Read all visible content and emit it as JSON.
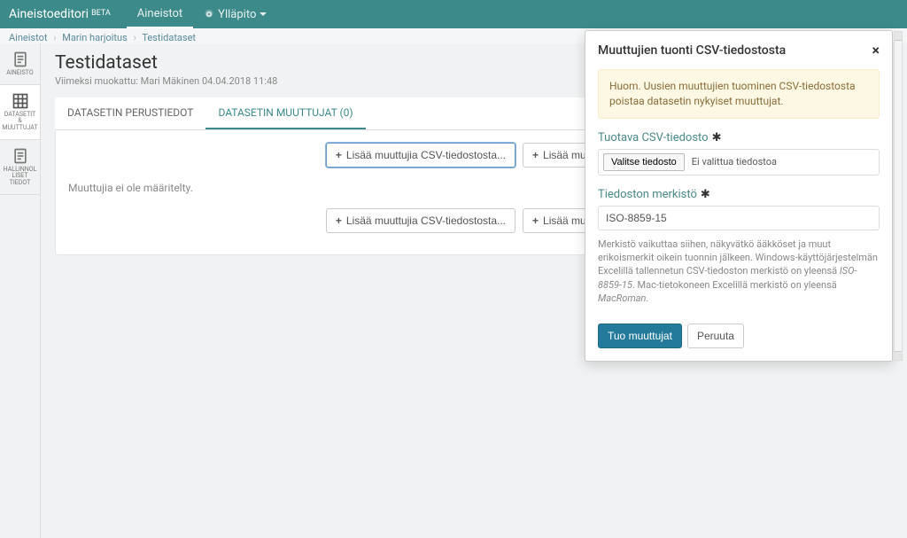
{
  "navbar": {
    "brand": "Aineistoeditori",
    "brand_badge": "BETA",
    "link_aineistot": "Aineistot",
    "link_yllapito": "Ylläpito"
  },
  "breadcrumb": {
    "level1": "Aineistot",
    "level2": "Marin harjoitus",
    "level3": "Testidataset"
  },
  "sidebar": {
    "item1": "AINEISTO",
    "item2": "DATASETIT & MUUTTUJAT",
    "item3": "HALLINNOLLISET TIEDOT"
  },
  "page": {
    "title": "Testidataset",
    "subtitle": "Viimeksi muokattu: Mari Mäkinen 04.04.2018 11:48"
  },
  "tabs": {
    "tab1": "DATASETIN PERUSTIEDOT",
    "tab2": "DATASETIN MUUTTUJAT (0)"
  },
  "content": {
    "btn_import_csv": "Lisää muuttujia CSV-tiedostosta...",
    "btn_add_var": "Lisää muuttuja",
    "empty": "Muuttujia ei ole määritelty."
  },
  "modal": {
    "title": "Muuttujien tuonti CSV-tiedostosta",
    "warning": "Huom. Uusien muuttujien tuominen CSV-tiedostosta poistaa datasetin nykyiset muuttujat.",
    "file_label": "Tuotava CSV-tiedosto",
    "file_button": "Valitse tiedosto",
    "file_status": "Ei valittua tiedostoa",
    "encoding_label": "Tiedoston merkistö",
    "encoding_value": "ISO-8859-15",
    "help_1": "Merkistö vaikuttaa siihen, näkyvätkö ääkköset ja muut erikoismerkit oikein tuonnin jälkeen. Windows-käyttöjärjestelmän Excelillä tallennetun CSV-tiedoston merkistö on yleensä ",
    "help_em1": "ISO-8859-15",
    "help_2": ". Mac-tietokoneen Excelillä merkistö on yleensä ",
    "help_em2": "MacRoman",
    "help_3": ".",
    "submit": "Tuo muuttujat",
    "cancel": "Peruuta"
  }
}
